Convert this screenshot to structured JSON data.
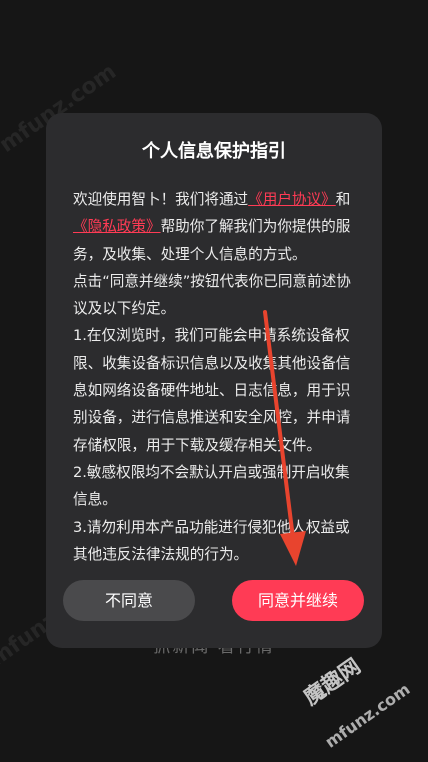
{
  "background_text": "抓新闻 看行情",
  "dialog": {
    "title": "个人信息保护指引",
    "para1": {
      "prefix": "欢迎使用智卜！我们将通过",
      "link1": "《用户协议》",
      "mid": "和",
      "link2": "《隐私政策》",
      "suffix": "帮助你了解我们为你提供的服务，及收集、处理个人信息的方式。"
    },
    "para2": "点击“同意并继续”按钮代表你已同意前述协议及以下约定。",
    "para3": "1.在仅浏览时，我们可能会申请系统设备权限、收集设备标识信息以及收集其他设备信息如网络设备硬件地址、日志信息，用于识别设备，进行信息推送和安全风控，并申请存储权限，用于下载及缓存相关文件。",
    "para4": "2.敏感权限均不会默认开启或强制开启收集信息。",
    "para5": "3.请勿利用本产品功能进行侵犯他人权益或其他违反法律法规的行为。",
    "decline_label": "不同意",
    "accept_label": "同意并继续"
  },
  "watermark": {
    "text": "mfunz.com",
    "brand": "魔趣网",
    "brand_url": "mfunz.com"
  },
  "colors": {
    "accent": "#ff3b55",
    "dialog_bg": "#2c2c2e",
    "annotation_arrow": "#e8442e"
  }
}
